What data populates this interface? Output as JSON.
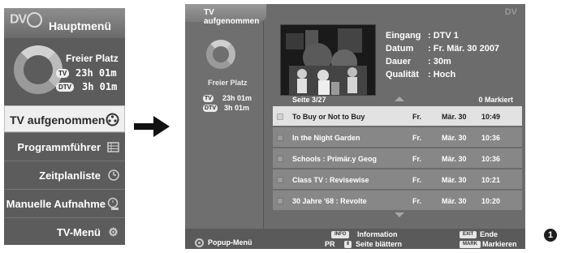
{
  "left_menu": {
    "logo": "DV",
    "title": "Hauptmenü",
    "storage": {
      "label": "Freier Platz",
      "tv_badge": "TV",
      "tv_time": "23h 01m",
      "dtv_badge": "DTV",
      "dtv_time": "3h 01m"
    },
    "items": [
      {
        "label": "TV aufgenommen",
        "icon": "record-reel-icon",
        "active": true
      },
      {
        "label": "Programmführer",
        "icon": "guide-grid-icon",
        "active": false
      },
      {
        "label": "Zeitplanliste",
        "icon": "clock-icon",
        "active": false
      },
      {
        "label": "Manuelle Aufnahme",
        "icon": "manual-record-icon",
        "active": false
      },
      {
        "label": "TV-Menü",
        "icon": "gear-icon",
        "active": false
      }
    ]
  },
  "recorded_panel": {
    "tab_title": "TV aufgenommen",
    "logo": "DV",
    "storage": {
      "label": "Freier Platz",
      "tv_badge": "TV",
      "tv_time": "23h 01m",
      "dtv_badge": "DTV",
      "dtv_time": "3h 01m"
    },
    "info": [
      {
        "key": "Eingang",
        "value": ": DTV 1"
      },
      {
        "key": "Datum",
        "value": ": Fr. Mär. 30 2007"
      },
      {
        "key": "Dauer",
        "value": ": 30m"
      },
      {
        "key": "Qualität",
        "value": ": Hoch"
      }
    ],
    "page_label": "Seite  3/27",
    "marked_label": "0 Markiert",
    "recordings": [
      {
        "title": "To Buy or Not to Buy",
        "day": "Fr.",
        "date": "Mär. 30",
        "time": "10:49",
        "selected": true
      },
      {
        "title": "In the Night Garden",
        "day": "Fr.",
        "date": "Mär. 30",
        "time": "10:36",
        "selected": false
      },
      {
        "title": "Schools : Primär.y Geog",
        "day": "Fr.",
        "date": "Mär. 30",
        "time": "10:36",
        "selected": false
      },
      {
        "title": "Class TV : Revisewise",
        "day": "Fr.",
        "date": "Mär. 30",
        "time": "10:21",
        "selected": false
      },
      {
        "title": "30 Jahre '68 : Revolte",
        "day": "Fr.",
        "date": "Mär. 30",
        "time": "10:20",
        "selected": false
      }
    ],
    "footer": {
      "popup": "Popup-Menü",
      "info_btn": "INFO",
      "info_label": "Information",
      "pr_label": "PR",
      "page_label": "Seite blättern",
      "exit_btn": "EXIT",
      "exit_label": "Ende",
      "mark_btn": "MARK",
      "mark_label": "Markieren"
    }
  },
  "step_number": "1"
}
